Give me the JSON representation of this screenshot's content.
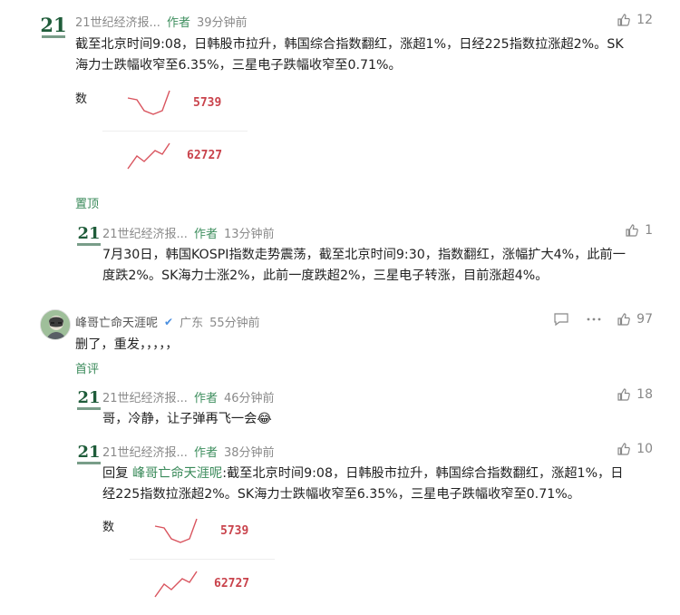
{
  "comments": [
    {
      "user": "21世纪经济报...",
      "author_tag": "作者",
      "time": "39分钟前",
      "likes": "12",
      "text_line1": "截至北京时间9:08，日韩股市拉升，韩国综合指数翻红，涨超1%，日经225指数拉涨超2%。SK",
      "text_line2": "海力士跌幅收窄至6.35%，三星电子跌幅收窄至0.71%。",
      "card": {
        "label": "数",
        "value1": "5739",
        "value2": "62727"
      },
      "action": "置顶"
    },
    {
      "user": "21世纪经济报...",
      "author_tag": "作者",
      "time": "13分钟前",
      "likes": "1",
      "text_line1": "7月30日，韩国KOSPI指数走势震荡，截至北京时间9:30，指数翻红，涨幅扩大4%，此前一",
      "text_line2": "度跌2%。SK海力士涨2%，此前一度跌超2%，三星电子转涨，目前涨超4%。"
    },
    {
      "user": "峰哥亡命天涯呢",
      "location": "广东",
      "time": "55分钟前",
      "likes": "97",
      "text": "删了，重发，，，，，",
      "action": "首评"
    },
    {
      "user": "21世纪经济报...",
      "author_tag": "作者",
      "time": "46分钟前",
      "likes": "18",
      "text": "哥，冷静，让子弹再飞一会😂"
    },
    {
      "user": "21世纪经济报...",
      "author_tag": "作者",
      "time": "38分钟前",
      "likes": "10",
      "reply_prefix": "回复 ",
      "reply_to": "峰哥亡命天涯呢",
      "text_line1": ":截至北京时间9:08，日韩股市拉升，韩国综合指数翻红，涨超1%，日",
      "text_line2": "经225指数拉涨超2%。SK海力士跌幅收窄至6.35%，三星电子跌幅收窄至0.71%。",
      "card": {
        "label": "数",
        "value1": "5739",
        "value2": "62727"
      }
    }
  ],
  "colors": {
    "accent_green": "#3a8a5a",
    "stock_red": "#c9434c",
    "meta_gray": "#8a8a8a"
  },
  "icons": {
    "like": "thumbs-up-icon",
    "comment": "comment-icon",
    "more": "more-dots-icon",
    "verified": "verified-badge-icon"
  }
}
